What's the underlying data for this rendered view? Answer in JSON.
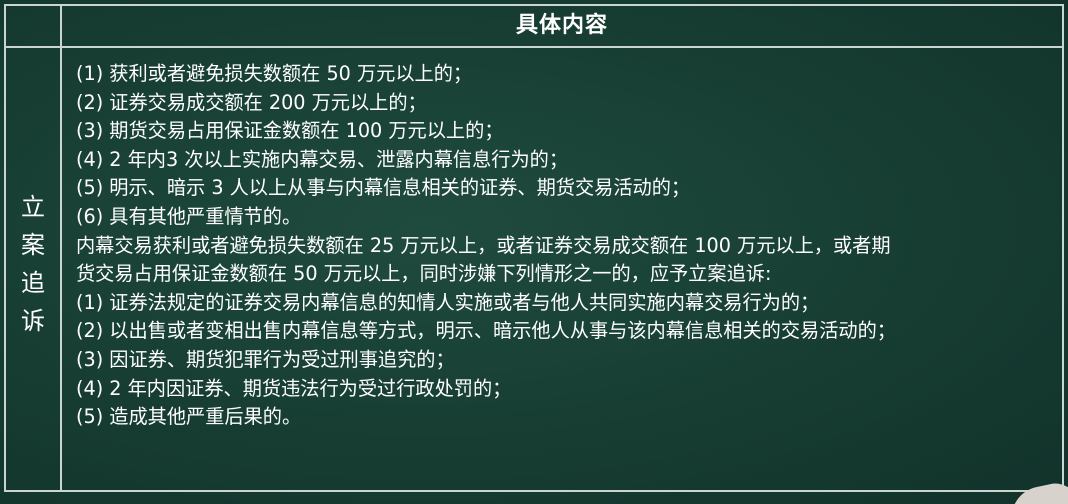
{
  "table": {
    "header": "具体内容",
    "left_label": "立案追诉",
    "lines": [
      "(1) 获利或者避免损失数额在 50 万元以上的；",
      "(2) 证券交易成交额在 200 万元以上的；",
      "(3) 期货交易占用保证金数额在 100 万元以上的；",
      "(4) 2 年内3 次以上实施内幕交易、泄露内幕信息行为的；",
      "(5) 明示、暗示 3 人以上从事与内幕信息相关的证券、期货交易活动的；",
      "(6) 具有其他严重情节的。",
      "内幕交易获利或者避免损失数额在 25 万元以上，或者证券交易成交额在 100 万元以上，或者期",
      "货交易占用保证金数额在 50 万元以上，同时涉嫌下列情形之一的，应予立案追诉:",
      "(1) 证券法规定的证券交易内幕信息的知情人实施或者与他人共同实施内幕交易行为的；",
      "(2) 以出售或者变相出售内幕信息等方式，明示、暗示他人从事与该内幕信息相关的交易活动的；",
      "(3) 因证券、期货犯罪行为受过刑事追究的；",
      "(4) 2 年内因证券、期货违法行为受过行政处罚的；",
      "(5) 造成其他严重后果的。"
    ]
  },
  "colors": {
    "board": "#173d32",
    "border": "#c9d6cf",
    "text": "#ffffff"
  }
}
